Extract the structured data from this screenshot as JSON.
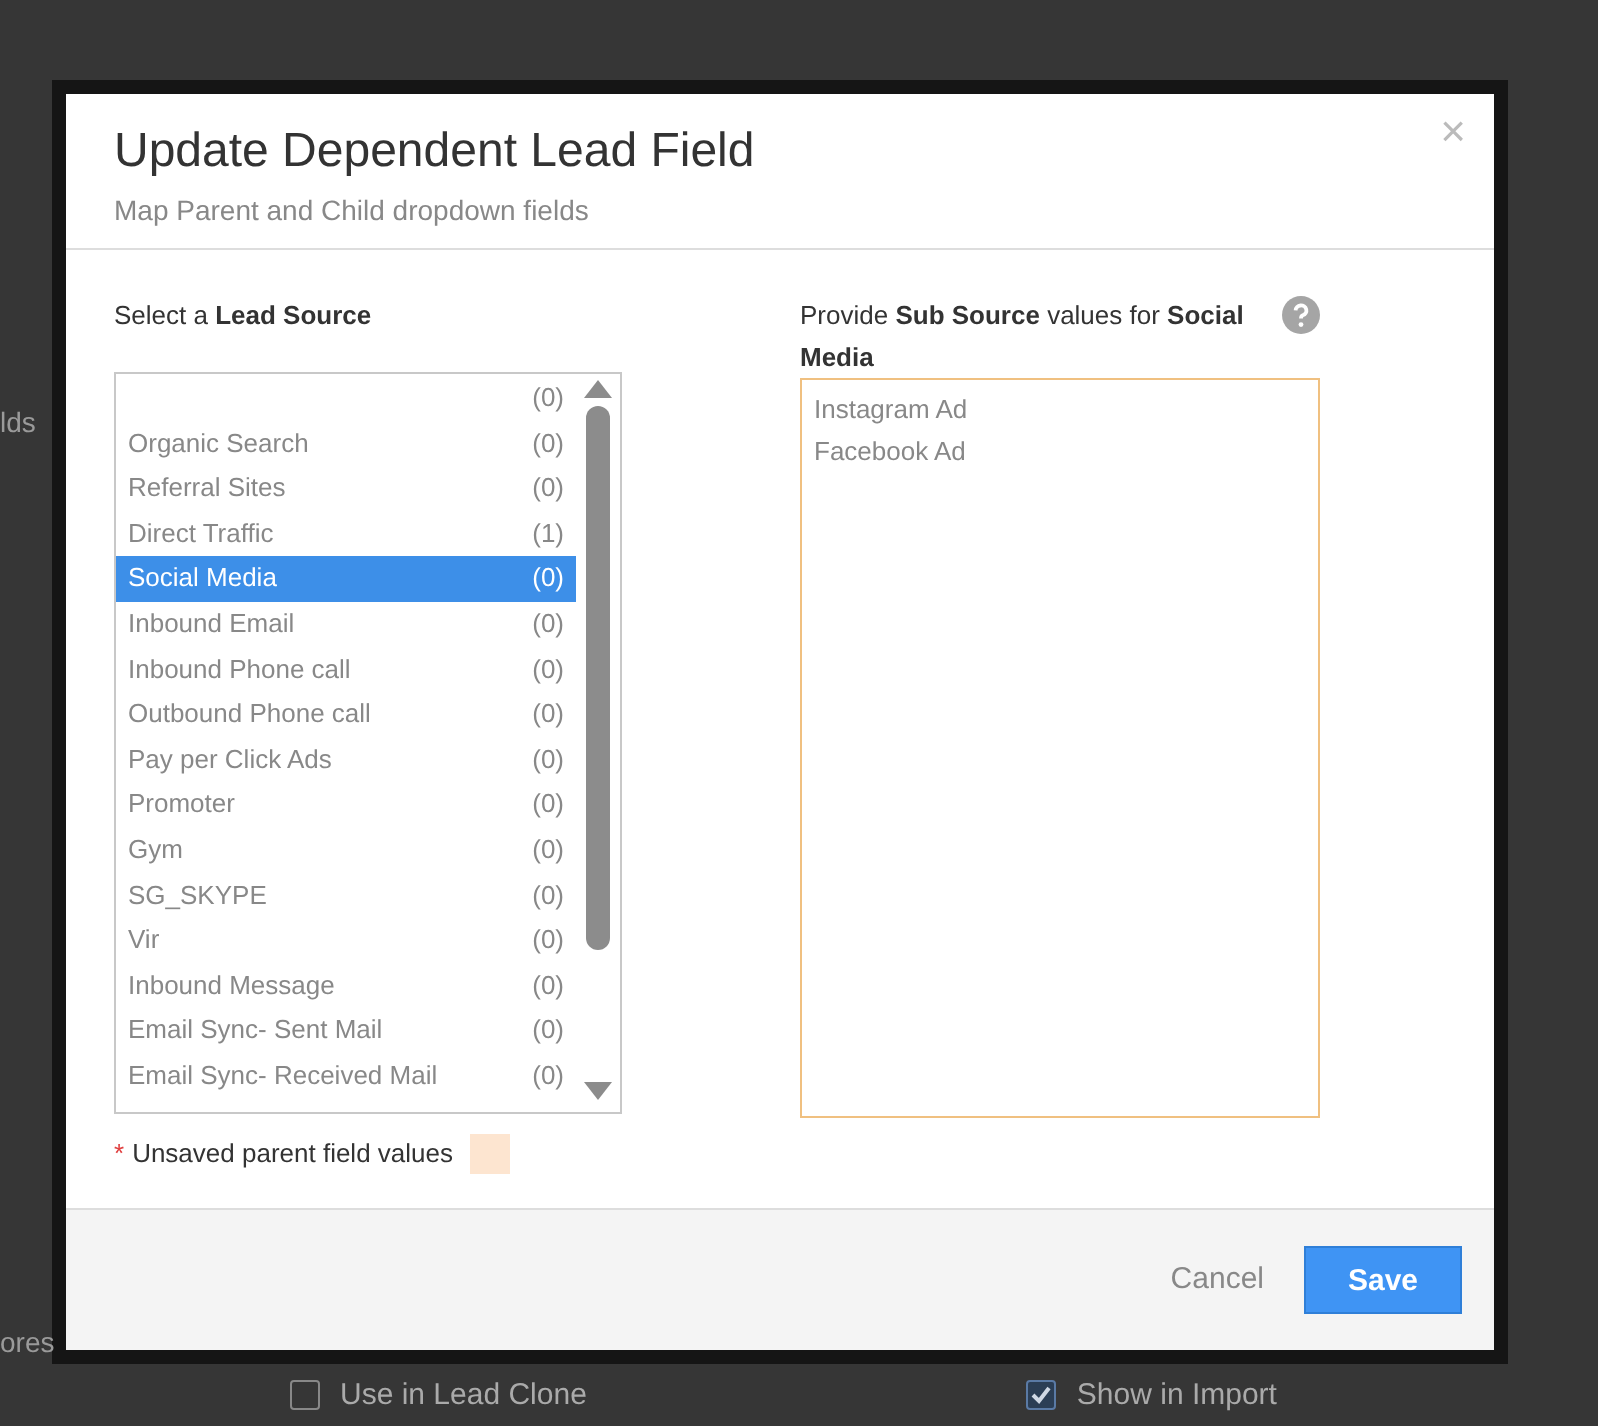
{
  "background": {
    "fragments": [
      "lds",
      "ores"
    ],
    "checkboxes": [
      {
        "label": "Use in Lead Clone",
        "checked": false
      },
      {
        "label": "Show in Import",
        "checked": true
      }
    ]
  },
  "dialog": {
    "title": "Update Dependent Lead Field",
    "subtitle": "Map Parent and Child dropdown fields",
    "close": "×",
    "parent_heading": "Select a **Lead Source**",
    "parent_items": [
      {
        "count": "(0)",
        "selected": false
      },
      {
        "name": "Organic Search",
        "count": "(0)",
        "selected": false
      },
      {
        "name": "Referral Sites",
        "count": "(0)",
        "selected": false
      },
      {
        "name": "Direct Traffic",
        "count": "(1)",
        "selected": false
      },
      {
        "name": "Social Media",
        "count": "(0)",
        "selected": true
      },
      {
        "name": "Inbound Email",
        "count": "(0)",
        "selected": false
      },
      {
        "name": "Inbound Phone call",
        "count": "(0)",
        "selected": false
      },
      {
        "name": "Outbound Phone call",
        "count": "(0)",
        "selected": false
      },
      {
        "name": "Pay per Click Ads",
        "count": "(0)",
        "selected": false
      },
      {
        "name": "Promoter",
        "count": "(0)",
        "selected": false
      },
      {
        "name": "Gym",
        "count": "(0)",
        "selected": false
      },
      {
        "name": "SG_SKYPE",
        "count": "(0)",
        "selected": false
      },
      {
        "name": "Vir",
        "count": "(0)",
        "selected": false
      },
      {
        "name": "Inbound Message",
        "count": "(0)",
        "selected": false
      },
      {
        "name": "Email Sync- Sent Mail",
        "count": "(0)",
        "selected": false
      },
      {
        "name": "Email Sync- Received Mail",
        "count": "(0)",
        "selected": false
      }
    ],
    "legend": {
      "mark": "*",
      "text": "Unsaved parent field values"
    },
    "child_heading": "Provide **Sub Source** values for **Social Media**",
    "child_values": [
      "Instagram Ad",
      "Facebook Ad"
    ],
    "buttons": [
      {
        "kind": "link",
        "label": "Cancel"
      },
      {
        "kind": "primary",
        "label": "Save"
      }
    ]
  }
}
